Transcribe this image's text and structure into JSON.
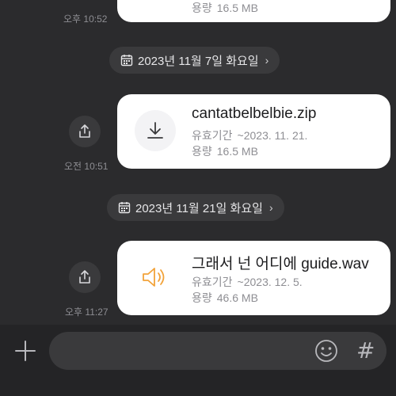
{
  "messages": [
    {
      "time": "오후 10:52",
      "card": {
        "meta_size_label": "용량",
        "meta_size_value": "16.5 MB"
      }
    },
    {
      "date_label": "2023년 11월 7일 화요일",
      "time": "오전 10:51",
      "card": {
        "file_name": "cantatbelbelbie.zip",
        "meta_expiry_label": "유효기간",
        "meta_expiry_value": "~2023. 11. 21.",
        "meta_size_label": "용량",
        "meta_size_value": "16.5 MB",
        "icon": "download-icon"
      }
    },
    {
      "date_label": "2023년 11월 21일 화요일",
      "time": "오후 11:27",
      "card": {
        "file_name": "그래서 넌 어디에 guide.wav",
        "meta_expiry_label": "유효기간",
        "meta_expiry_value": "~2023. 12. 5.",
        "meta_size_label": "용량",
        "meta_size_value": "46.6 MB",
        "icon": "audio-file-icon"
      }
    }
  ],
  "composer": {
    "input_value": "",
    "hash_label": "#"
  },
  "colors": {
    "audio_accent": "#f2a33a",
    "background": "#2b2b2d",
    "card": "#ffffff"
  }
}
